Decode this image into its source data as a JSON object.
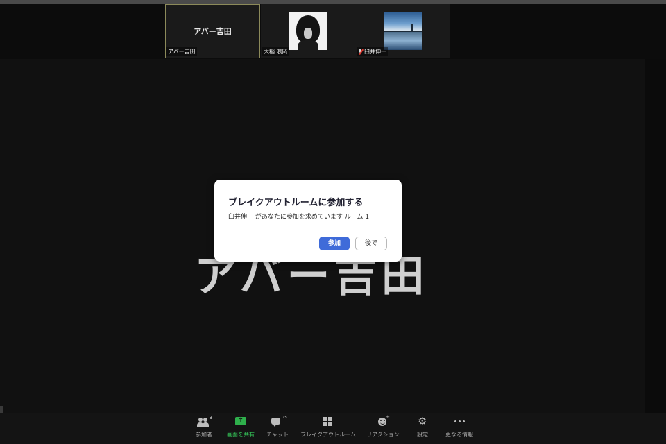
{
  "thumbnails": [
    {
      "center_name": "アバー吉田",
      "label": "アバー吉田",
      "active": true
    },
    {
      "label": "大稲 浪岡",
      "has_photo": true
    },
    {
      "label": "臼井伸一",
      "muted": true,
      "has_photo": true
    }
  ],
  "main": {
    "speaker_name": "アバー吉田"
  },
  "dialog": {
    "title": "ブレイクアウトルームに参加する",
    "message": "臼井伸一 があなたに参加を求めています ルーム 1",
    "join_label": "参加",
    "later_label": "後で"
  },
  "toolbar": {
    "participants_label": "参加者",
    "participants_count": "3",
    "share_label": "画面を共有",
    "chat_label": "チャット",
    "breakout_label": "ブレイクアウトルーム",
    "reactions_label": "リアクション",
    "settings_label": "設定",
    "more_label": "更なる情報"
  },
  "colors": {
    "background": "#111111",
    "accent_blue": "#3f6bd9",
    "share_green": "#35c759",
    "active_border": "#8c8a5a",
    "muted_red": "#e0382f"
  },
  "icons": {
    "participants": "participants-icon",
    "share": "share-screen-icon",
    "chat": "chat-icon",
    "breakout": "breakout-grid-icon",
    "reactions": "reaction-smile-icon",
    "settings": "gear-icon",
    "more": "more-dots-icon",
    "muted": "mic-muted-icon"
  }
}
